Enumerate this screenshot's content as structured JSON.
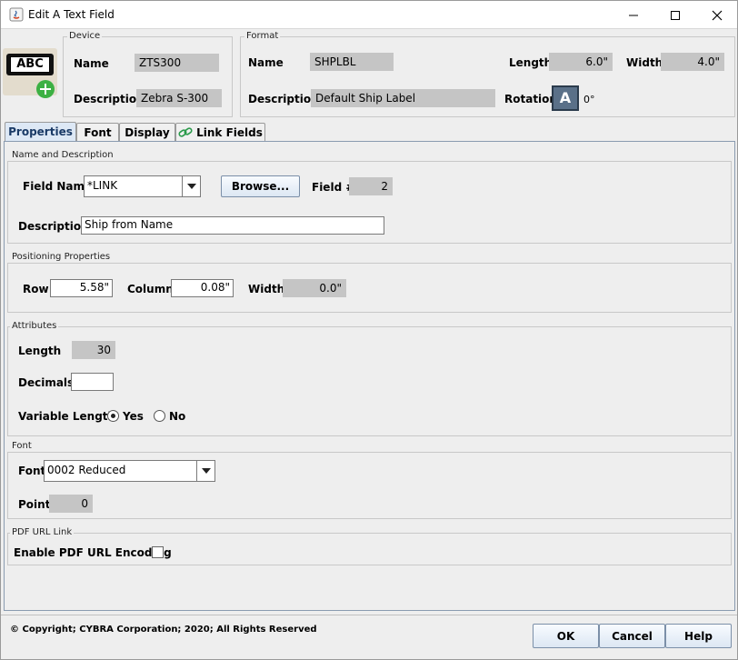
{
  "window": {
    "title": "Edit A Text Field"
  },
  "device": {
    "group_title": "Device",
    "name_label": "Name",
    "name_value": "ZTS300",
    "description_label": "Description",
    "description_value": "Zebra S-300",
    "icon_text": "ABC"
  },
  "format": {
    "group_title": "Format",
    "name_label": "Name",
    "name_value": "SHPLBL",
    "length_label": "Length",
    "length_value": "6.0\"",
    "width_label": "Width",
    "width_value": "4.0\"",
    "description_label": "Description",
    "description_value": "Default Ship Label",
    "rotation_label": "Rotation",
    "rotation_icon_text": "A",
    "rotation_value": "0°"
  },
  "tabs": [
    {
      "label": "Properties",
      "active": true
    },
    {
      "label": "Font",
      "active": false
    },
    {
      "label": "Display",
      "active": false
    },
    {
      "label": "Link Fields",
      "active": false
    }
  ],
  "name_description": {
    "title": "Name and Description",
    "field_name_label": "Field Name",
    "field_name_value": "*LINK",
    "browse_label": "Browse...",
    "field_number_label": "Field #",
    "field_number_value": "2",
    "description_label": "Description",
    "description_value": "Ship from Name"
  },
  "positioning": {
    "title": "Positioning Properties",
    "row_label": "Row",
    "row_value": "5.58\"",
    "column_label": "Column",
    "column_value": "0.08\"",
    "width_label": "Width",
    "width_value": "0.0\""
  },
  "attributes": {
    "title": "Attributes",
    "length_label": "Length",
    "length_value": "30",
    "decimals_label": "Decimals",
    "decimals_value": "",
    "variable_length_label": "Variable Length",
    "yes_label": "Yes",
    "no_label": "No",
    "variable_length_selected": "Yes"
  },
  "font": {
    "title": "Font",
    "font_label": "Font",
    "font_value": "0002 Reduced",
    "point_label": "Point",
    "point_value": "0"
  },
  "pdf": {
    "title": "PDF URL Link",
    "enable_label": "Enable PDF URL Encoding",
    "enabled": false
  },
  "footer": {
    "copyright": "© Copyright; CYBRA Corporation; 2020; All Rights Reserved",
    "ok_label": "OK",
    "cancel_label": "Cancel",
    "help_label": "Help"
  },
  "colors": {
    "accent": "#1a3a66",
    "readonly_bg": "#c5c5c5",
    "plus_green": "#3cb043"
  }
}
